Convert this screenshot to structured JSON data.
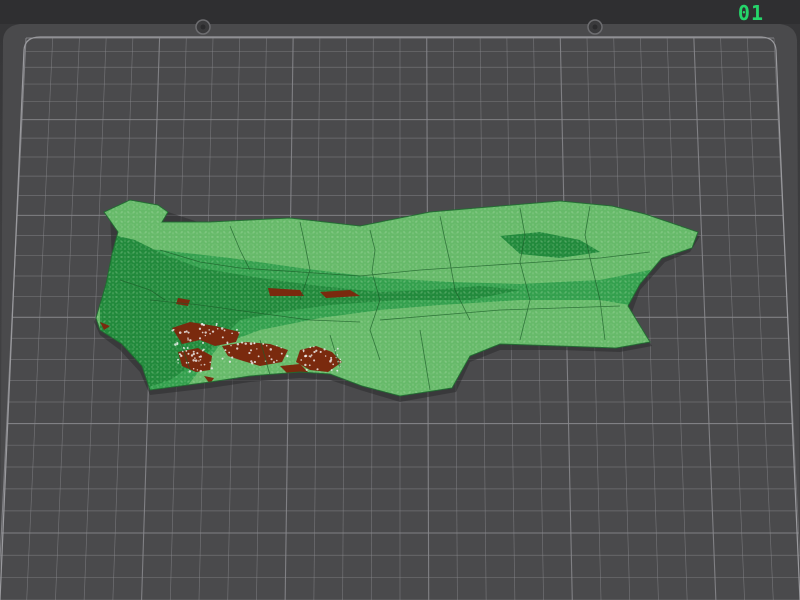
{
  "plate": {
    "label": "01",
    "label_color": "#25d46a",
    "bed_color": "#4a4a4c",
    "grid_color": "#8a8a8e"
  },
  "model": {
    "lowland_color": "#67ba6a",
    "midland_color": "#34a04e",
    "forest_color": "#228a3c",
    "mountain_color": "#7a2a0e",
    "snow_color": "#f2f2f2"
  },
  "icons": [
    "pin-icon",
    "pin-icon"
  ]
}
